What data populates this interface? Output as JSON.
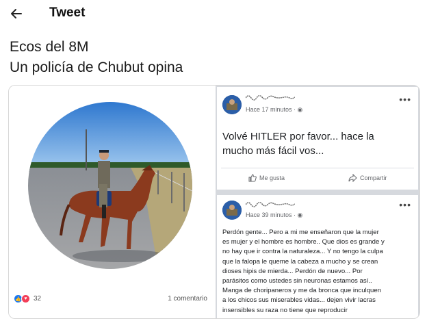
{
  "header": {
    "back_icon": "arrow-left-icon",
    "title": "Tweet"
  },
  "tweet": {
    "line1": "Ecos del 8M",
    "line2": "Un policía de Chubut opina"
  },
  "image_left": {
    "reaction_icons": [
      "like-icon",
      "love-icon"
    ],
    "reaction_count": "32",
    "comments": "1 comentario"
  },
  "post1": {
    "time": "Hace 17 minutos · ",
    "text_line1": "Volvé HITLER por favor... hace la",
    "text_line2": "mucho más fácil vos...",
    "like_label": "Me gusta",
    "share_label": "Compartir"
  },
  "post2": {
    "time": "Hace 39 minutos · ",
    "lines": [
      "Perdón gente... Pero a mi me enseñaron que la mujer",
      "es mujer y el hombre es hombre.. Que dios es grande y",
      "no hay que ir contra la naturaleza... Y no tengo la culpa",
      "que la falopa le queme la cabeza a mucho y se crean",
      "dioses hipis de mierda... Perdón de nuevo... Por",
      "parásitos como ustedes sin neuronas estamos así..",
      " Manga de choripaneros y me da bronca que inculquen",
      "a los chicos sus miserables vidas... dejen vivir lacras",
      "insensibles su raza no tiene que reproducir"
    ]
  },
  "colors": {
    "fb_blue": "#1877f2",
    "love_red": "#f33e58",
    "feed_gray": "#d6d9de",
    "meta_gray": "#65676b"
  }
}
